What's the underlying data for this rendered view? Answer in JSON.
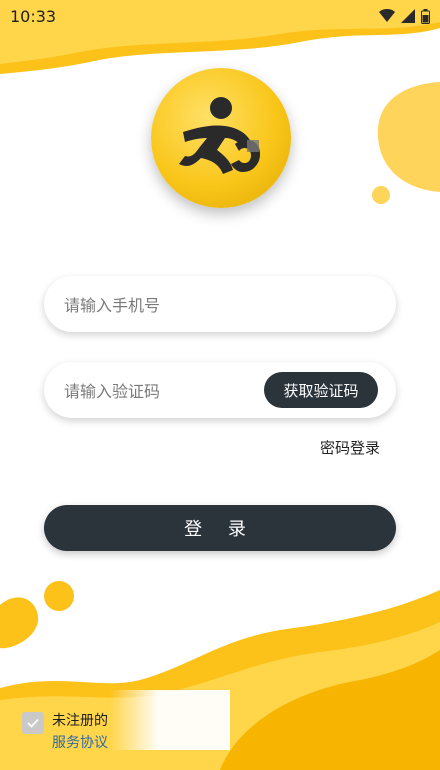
{
  "status_bar": {
    "time": "10:33",
    "icons": [
      "wifi-icon",
      "signal-icon",
      "battery-icon"
    ]
  },
  "logo": {
    "icon": "runner-logo-icon"
  },
  "form": {
    "phone_placeholder": "请输入手机号",
    "code_placeholder": "请输入验证码",
    "get_code_label": "获取验证码",
    "password_login_label": "密码登录",
    "login_label": "登 录"
  },
  "agreement": {
    "checked": true,
    "text": "未注册的",
    "link": "服务协议"
  },
  "colors": {
    "accent_yellow": "#f9c61a",
    "dark_button": "#2b333b",
    "link_blue": "#2e6aa6"
  }
}
